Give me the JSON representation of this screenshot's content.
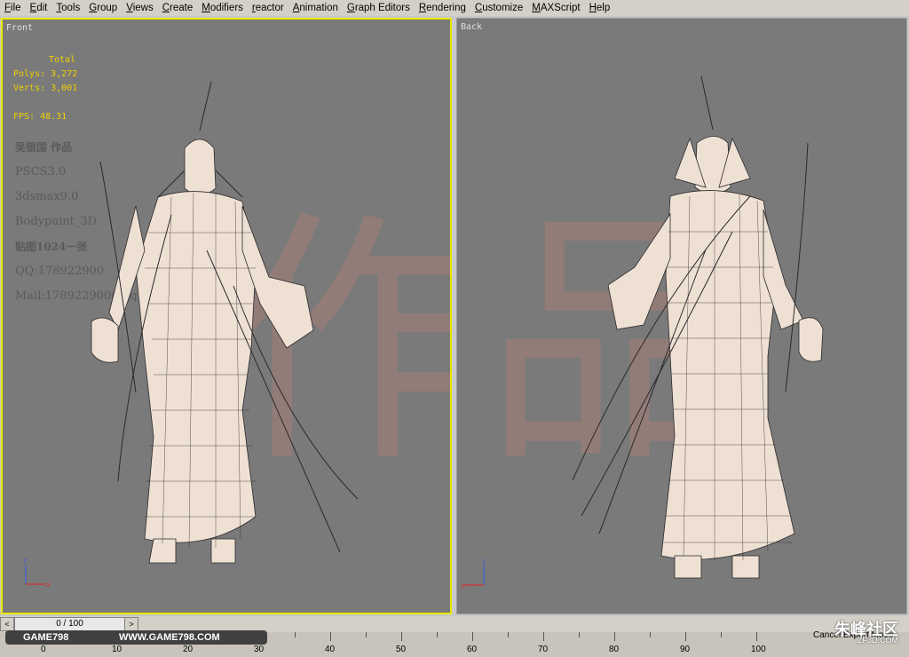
{
  "menu": [
    "File",
    "Edit",
    "Tools",
    "Group",
    "Views",
    "Create",
    "Modifiers",
    "reactor",
    "Animation",
    "Graph Editors",
    "Rendering",
    "Customize",
    "MAXScript",
    "Help"
  ],
  "viewports": {
    "front": {
      "label": "Front"
    },
    "back": {
      "label": "Back"
    }
  },
  "stats": {
    "total": "Total",
    "polys": "Polys: 3,272",
    "verts": "Verts: 3,001",
    "fps": "FPS:   48.31"
  },
  "credits": {
    "author": "吴银国 作品",
    "line1": "PSCS3.0",
    "line2": "3dsmax9.0",
    "line3": "Bodypaint_3D",
    "line4": "贴图1024一张",
    "line5": "QQ:178922900",
    "line6": "Mail:178922900@qq.com"
  },
  "watermark": {
    "char1": "作",
    "char2": "品"
  },
  "axis": {
    "z": "z",
    "x": "x"
  },
  "timeline": {
    "counter": "0 / 100",
    "prev": "<",
    "next": ">",
    "ticks": [
      "0",
      "10",
      "20",
      "30",
      "40",
      "50",
      "60",
      "70",
      "80",
      "90",
      "100"
    ]
  },
  "banner": {
    "left": "GAME798",
    "right": "WWW.GAME798.COM"
  },
  "logo": {
    "main": "朱峰社区",
    "sub": "ZF3D.COM"
  },
  "status": {
    "cancel": "Cancel Expert Mode"
  }
}
